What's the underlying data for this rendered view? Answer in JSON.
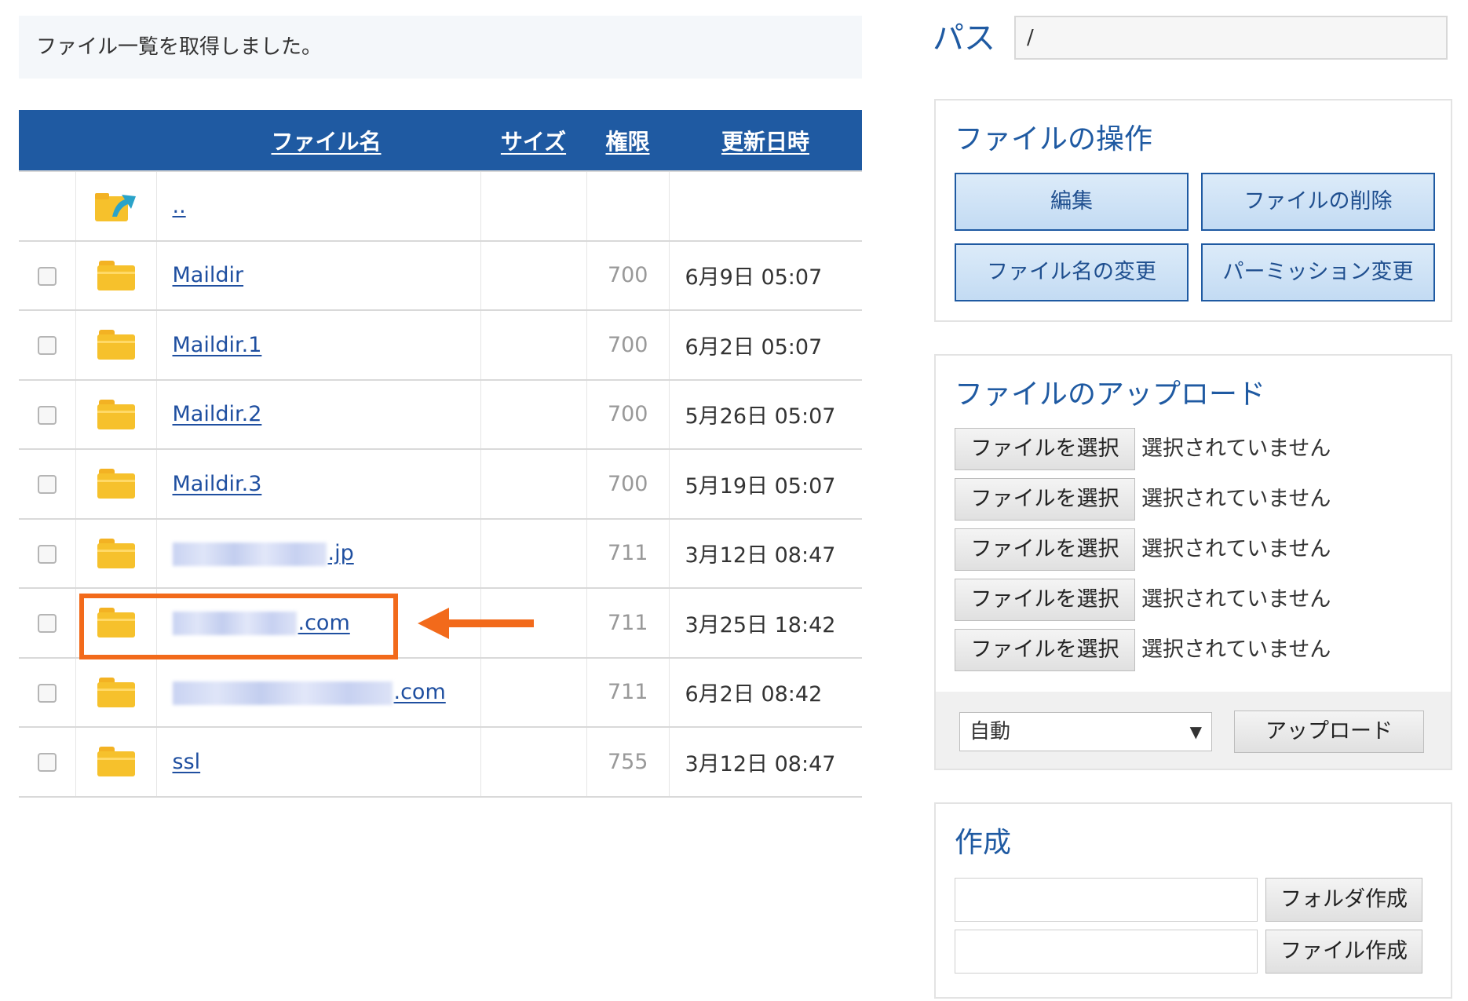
{
  "notice": "ファイル一覧を取得しました。",
  "table": {
    "headers": {
      "name": "ファイル名",
      "size": "サイズ",
      "perm": "権限",
      "date": "更新日時"
    },
    "parent_link": "..",
    "rows": [
      {
        "name": "Maildir",
        "perm": "700",
        "date": "6月9日 05:07"
      },
      {
        "name": "Maildir.1",
        "perm": "700",
        "date": "6月2日 05:07"
      },
      {
        "name": "Maildir.2",
        "perm": "700",
        "date": "5月26日 05:07"
      },
      {
        "name": "Maildir.3",
        "perm": "700",
        "date": "5月19日 05:07"
      },
      {
        "name": ".jp",
        "perm": "711",
        "date": "3月12日 08:47"
      },
      {
        "name": ".com",
        "perm": "711",
        "date": "3月25日 18:42"
      },
      {
        "name": ".com",
        "perm": "711",
        "date": "6月2日 08:42"
      },
      {
        "name": "ssl",
        "perm": "755",
        "date": "3月12日 08:47"
      }
    ]
  },
  "path": {
    "label": "パス",
    "value": "/"
  },
  "operations": {
    "title": "ファイルの操作",
    "edit": "編集",
    "delete": "ファイルの削除",
    "rename": "ファイル名の変更",
    "permission": "パーミッション変更"
  },
  "upload": {
    "title": "ファイルのアップロード",
    "choose_label": "ファイルを選択",
    "no_file": "選択されていません",
    "mode": "自動",
    "upload_button": "アップロード"
  },
  "create": {
    "title": "作成",
    "folder_button": "フォルダ作成",
    "file_button": "ファイル作成"
  },
  "colors": {
    "header_blue": "#1f5aa2",
    "link_blue": "#1f4fa0",
    "highlight_orange": "#f26a1b",
    "folder_yellow": "#f6c12c"
  }
}
